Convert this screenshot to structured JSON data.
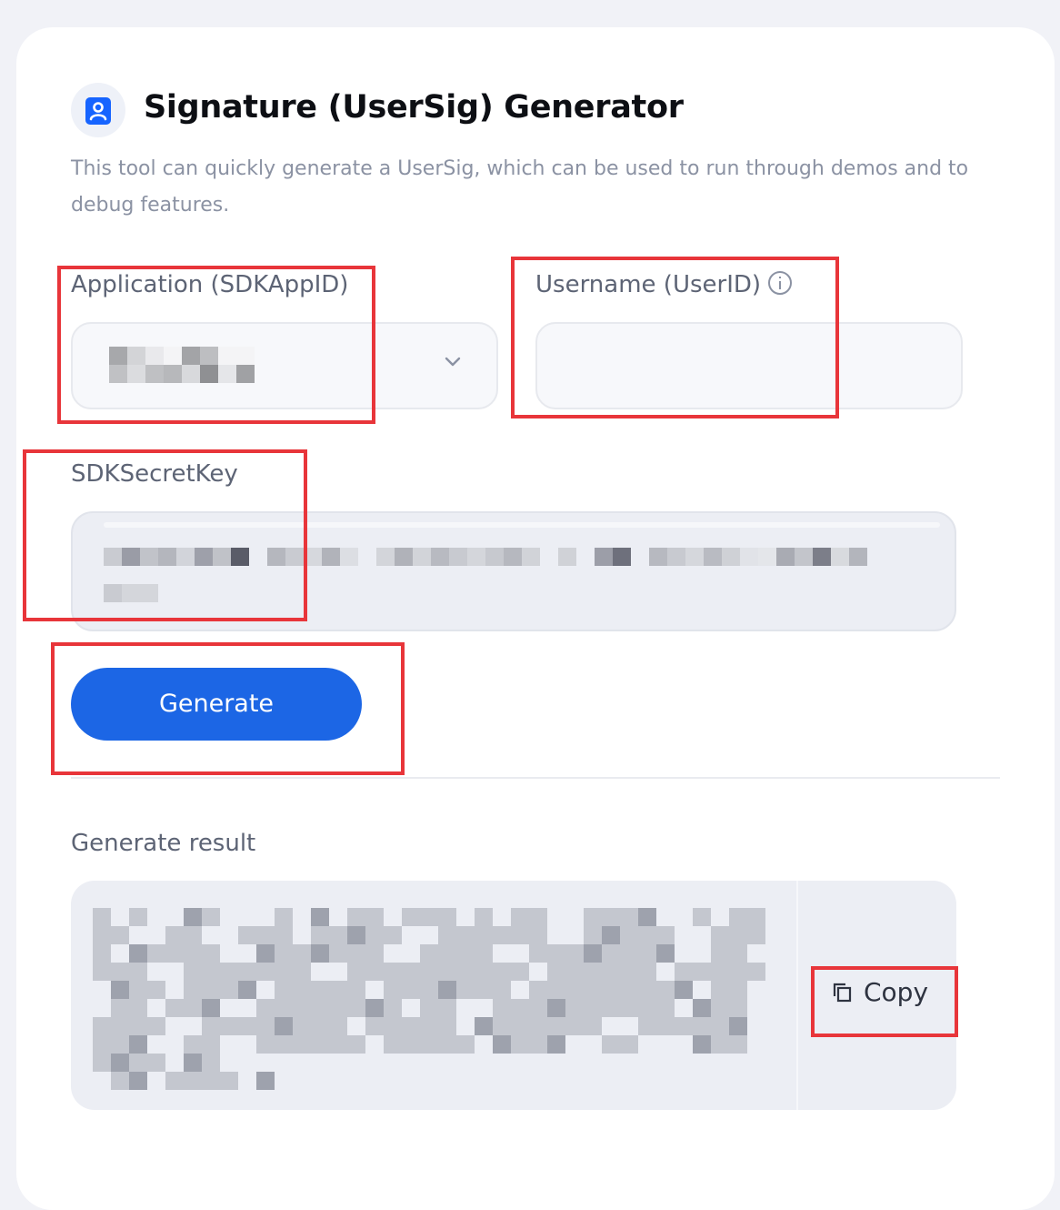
{
  "header": {
    "title": "Signature (UserSig) Generator",
    "description": "This tool can quickly generate a UserSig, which can be used to run through demos and to debug features.",
    "logo_icon": "user-badge-icon"
  },
  "form": {
    "app_label": "Application (SDKAppID)",
    "app_value": "",
    "userid_label": "Username (UserID)",
    "userid_value": "",
    "secret_label": "SDKSecretKey",
    "secret_value": "",
    "generate_label": "Generate"
  },
  "result": {
    "label": "Generate result",
    "value": "",
    "copy_label": "Copy"
  },
  "colors": {
    "accent": "#1c66e5",
    "highlight_red": "#e8353a",
    "background": "#f1f2f7"
  }
}
